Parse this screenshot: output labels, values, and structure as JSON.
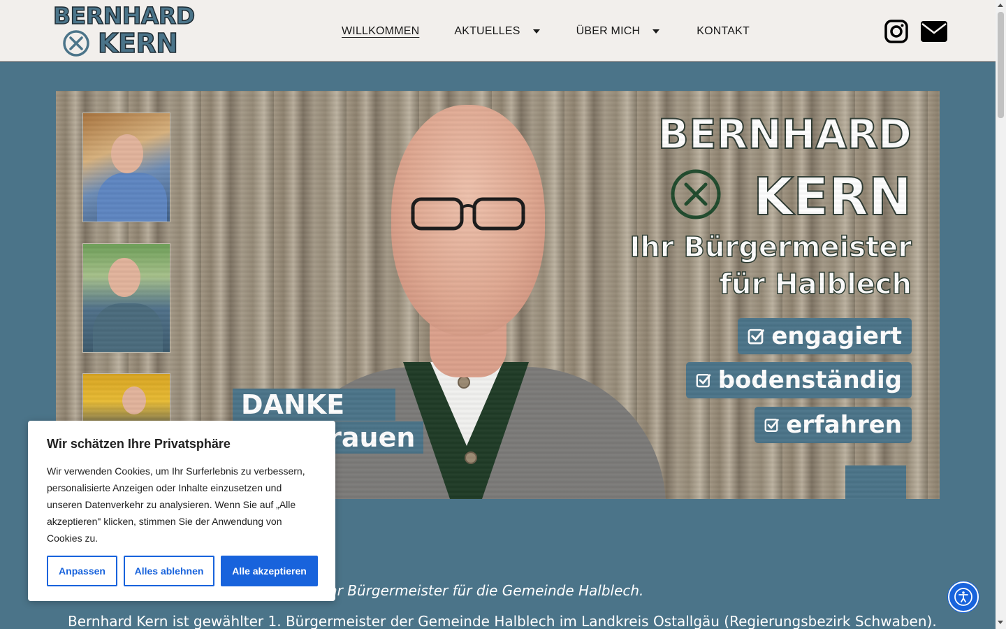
{
  "brand": {
    "logo_line1": "BERNHARD",
    "logo_line2": "KERN",
    "accent": "#4b7489",
    "dark": "#1e2b33"
  },
  "nav": {
    "items": [
      {
        "label": "WILLKOMMEN",
        "active": true,
        "dropdown": false
      },
      {
        "label": "AKTUELLES",
        "active": false,
        "dropdown": true
      },
      {
        "label": "ÜBER MICH",
        "active": false,
        "dropdown": true
      },
      {
        "label": "KONTAKT",
        "active": false,
        "dropdown": false
      }
    ],
    "social": [
      "instagram-icon",
      "envelope-icon"
    ]
  },
  "hero": {
    "title_line1": "BERNHARD",
    "title_line2": "KERN",
    "subtitle_line1": "Ihr Bürgermeister",
    "subtitle_line2": "für Halblech",
    "badges": [
      "engagiert",
      "bodenständig",
      "erfahren"
    ],
    "danke_line1": "DANKE für",
    "danke_line2": "trauen"
  },
  "content": {
    "line1": "hr Bürgermeister für die Gemeinde Halblech.",
    "line2": "Bernhard Kern ist gewählter 1. Bürgermeister der Gemeinde Halblech im Landkreis Ostallgäu (Regierungsbezirk Schwaben)."
  },
  "cookie": {
    "title": "Wir schätzen Ihre Privatsphäre",
    "text": "Wir verwenden Cookies, um Ihr Surferlebnis zu verbessern, personalisierte Anzeigen oder Inhalte einzusetzen und unseren Datenverkehr zu analysieren. Wenn Sie auf „Alle akzeptieren\" klicken, stimmen Sie der Anwendung von Cookies zu.",
    "btn_customize": "Anpassen",
    "btn_reject": "Alles ablehnen",
    "btn_accept": "Alle akzeptieren",
    "accent": "#1863dc"
  },
  "accessibility": {
    "icon": "accessibility-icon"
  }
}
